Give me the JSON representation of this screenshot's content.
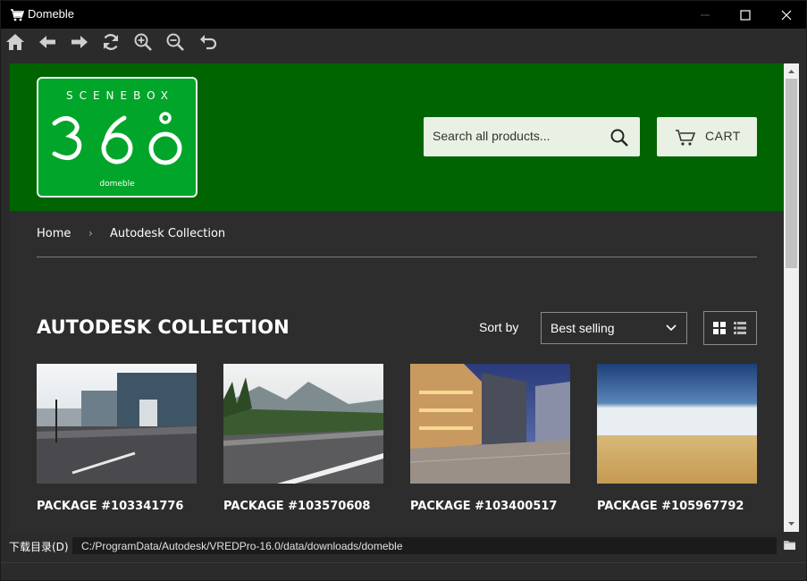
{
  "window": {
    "title": "Domeble",
    "icons": {
      "app": "cart-icon",
      "minimize": "minimize-icon",
      "maximize": "maximize-icon",
      "close": "close-icon"
    }
  },
  "toolbar": {
    "buttons": [
      {
        "name": "home",
        "icon": "home-icon"
      },
      {
        "name": "back",
        "icon": "arrow-left-icon"
      },
      {
        "name": "forward",
        "icon": "arrow-right-icon"
      },
      {
        "name": "reload",
        "icon": "reload-icon"
      },
      {
        "name": "zoom-in",
        "icon": "zoom-in-icon"
      },
      {
        "name": "zoom-out",
        "icon": "zoom-out-icon"
      },
      {
        "name": "undo",
        "icon": "undo-icon"
      }
    ]
  },
  "site": {
    "logo": {
      "top": "SCENEBOX",
      "number": "360",
      "sub": "domeble"
    },
    "search": {
      "placeholder": "Search all products...",
      "icon": "search-icon"
    },
    "cart": {
      "label": "CART",
      "icon": "cart-icon"
    },
    "colors": {
      "header_bg": "#006400",
      "logo_bg": "#00a52a",
      "page_bg": "#2d2d2d"
    }
  },
  "breadcrumb": {
    "home": "Home",
    "separator": "›",
    "current": "Autodesk Collection"
  },
  "collection": {
    "title": "AUTODESK COLLECTION",
    "sort_label": "Sort by",
    "sort_value": "Best selling",
    "view_icons": [
      "grid-view-icon",
      "list-view-icon"
    ]
  },
  "products": [
    {
      "name": "PACKAGE #103341776",
      "thumb": "city-road-buildings"
    },
    {
      "name": "PACKAGE #103570608",
      "thumb": "mountain-highway"
    },
    {
      "name": "PACKAGE #103400517",
      "thumb": "night-street-plaza"
    },
    {
      "name": "PACKAGE #105967792",
      "thumb": "desert-horizon"
    }
  ],
  "statusbar": {
    "label": "下载目录(D)",
    "path": "C:/ProgramData/Autodesk/VREDPro-16.0/data/downloads/domeble",
    "folder_icon": "folder-icon"
  }
}
